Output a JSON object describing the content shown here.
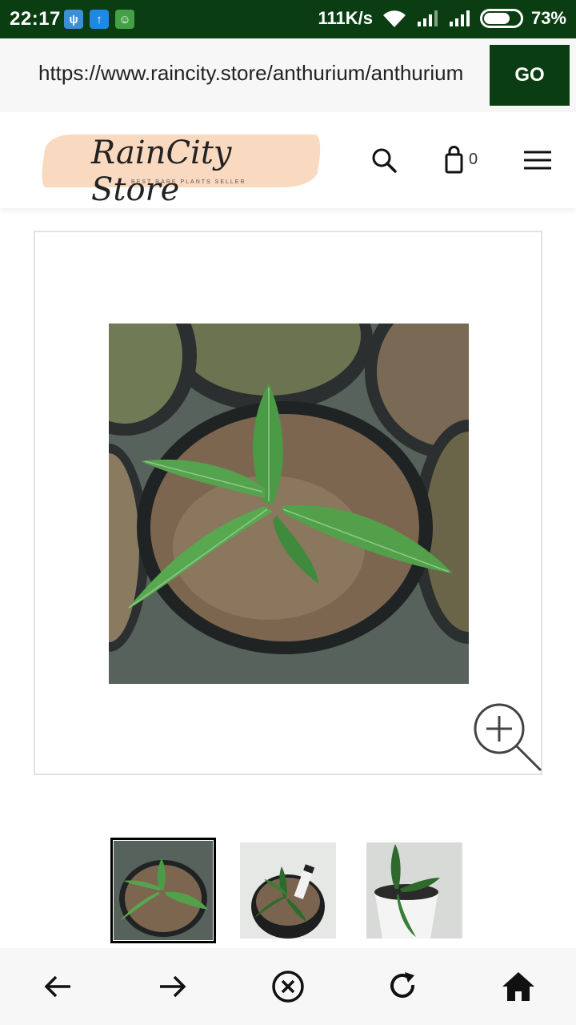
{
  "status_bar": {
    "time": "22:17",
    "notifications": [
      "usb-icon",
      "upload-icon",
      "android-icon"
    ],
    "net_speed": "111K/s",
    "battery": "73%",
    "battery_level": 0.73,
    "colors": {
      "background": "#0b3d12"
    }
  },
  "browser": {
    "url": "https://www.raincity.store/anthurium/anthurium",
    "go_label": "GO"
  },
  "site": {
    "logo_title": "RainCity Store",
    "logo_tagline": "BEST RARE PLANTS SELLER",
    "cart_count": "0",
    "icons": [
      "search-icon",
      "shopping-bag-icon",
      "hamburger-menu-icon"
    ]
  },
  "product": {
    "main_image": "anthurium-plant-in-pot-photo",
    "zoom_icon": "zoom-in-icon",
    "thumbnails": [
      "thumbnail-1",
      "thumbnail-2",
      "thumbnail-3"
    ],
    "active_thumbnail": 0
  },
  "bottom_nav": {
    "icons": [
      "back-arrow-icon",
      "forward-arrow-icon",
      "close-circle-icon",
      "refresh-icon",
      "home-icon"
    ]
  }
}
